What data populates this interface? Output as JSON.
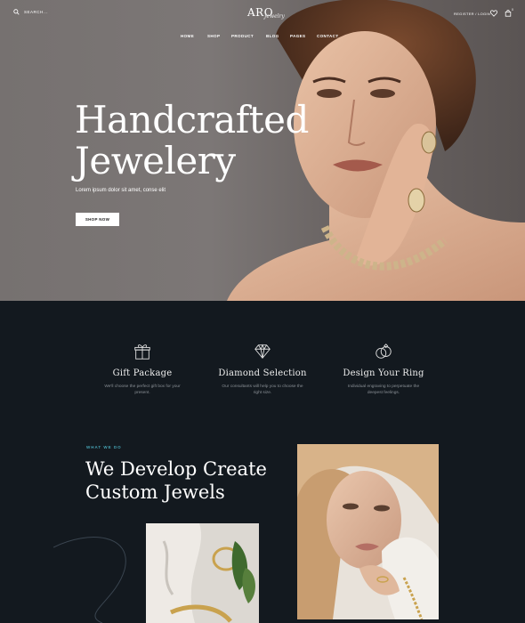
{
  "header": {
    "search_label": "SEARCH...",
    "logo_main": "ARO",
    "logo_sub": "Jewelry",
    "register_label": "REGISTER / LOGIN",
    "cart_count": "0"
  },
  "nav": [
    "HOME",
    "SHOP",
    "PRODUCT",
    "BLOG",
    "PAGES",
    "CONTACT"
  ],
  "hero": {
    "title_line1": "Handcrafted",
    "title_line2": "Jewelery",
    "subtitle": "Lorem ipsum dolor sit amet, conse elit",
    "button_label": "SHOP NOW"
  },
  "features": [
    {
      "title": "Gift Package",
      "text": "We'll choose the perfect gift box for your present.",
      "icon": "gift-icon"
    },
    {
      "title": "Diamond Selection",
      "text": "Our consultants will help you to choose the right size.",
      "icon": "diamond-icon"
    },
    {
      "title": "Design Your Ring",
      "text": "Individual engraving to perpetuate the deepest feelings.",
      "icon": "rings-icon"
    }
  ],
  "what_we_do": {
    "label": "WHAT WE DO",
    "title_line1": "We Develop Create",
    "title_line2": "Custom Jewels"
  },
  "colors": {
    "dark_bg": "#13191f",
    "accent": "#46a3b4"
  }
}
